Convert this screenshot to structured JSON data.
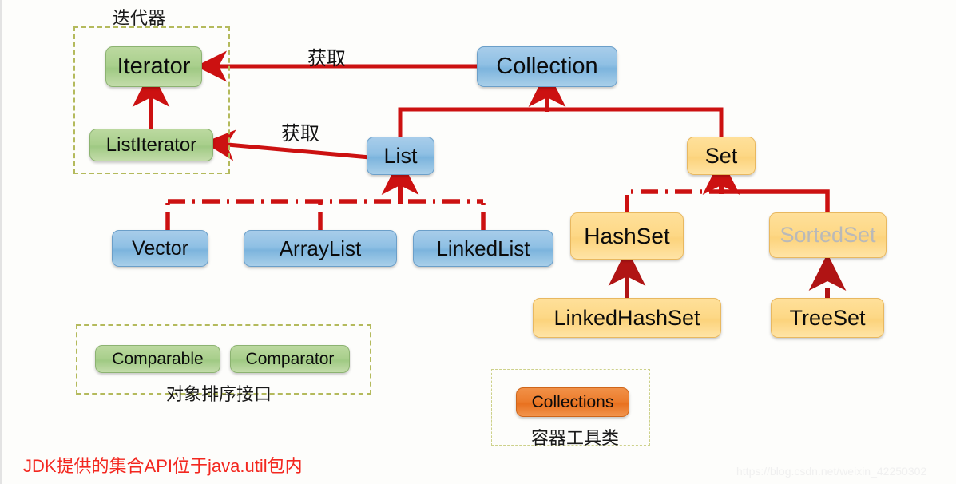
{
  "diagram": {
    "title_note": "JDK Collection API hierarchy",
    "colors": {
      "arrow_red": "#cc1111",
      "dark_red": "#b01414",
      "blue_box": "#8fc0e4",
      "green_box": "#a9cf8c",
      "amber_box": "#fdd886",
      "orange_box": "#ec7c2c",
      "frame_olive": "#b4ba5c",
      "footnote_red": "#f3271f",
      "muted_gray": "#b9b9b9",
      "background": "#fdfdfb"
    }
  },
  "nodes": {
    "iterator": {
      "label": "Iterator",
      "style": "green"
    },
    "list_iterator": {
      "label": "ListIterator",
      "style": "green"
    },
    "collection": {
      "label": "Collection",
      "style": "blue"
    },
    "list": {
      "label": "List",
      "style": "blue"
    },
    "set": {
      "label": "Set",
      "style": "amber"
    },
    "vector": {
      "label": "Vector",
      "style": "blue"
    },
    "array_list": {
      "label": "ArrayList",
      "style": "blue"
    },
    "linked_list": {
      "label": "LinkedList",
      "style": "blue"
    },
    "hash_set": {
      "label": "HashSet",
      "style": "amber"
    },
    "sorted_set": {
      "label": "SortedSet",
      "style": "amber-muted"
    },
    "linked_hash_set": {
      "label": "LinkedHashSet",
      "style": "amber"
    },
    "tree_set": {
      "label": "TreeSet",
      "style": "amber"
    },
    "comparable": {
      "label": "Comparable",
      "style": "green"
    },
    "comparator": {
      "label": "Comparator",
      "style": "green"
    },
    "collections": {
      "label": "Collections",
      "style": "orange"
    }
  },
  "groups": {
    "iterator_group": {
      "caption": "迭代器"
    },
    "sorting_group": {
      "caption": "对象排序接口"
    },
    "utility_group": {
      "caption": "容器工具类"
    }
  },
  "edge_labels": {
    "collection_to_iterator": "获取",
    "list_to_list_iterator": "获取"
  },
  "footnote": {
    "text": "JDK提供的集合API位于java.util包内"
  },
  "watermark": {
    "text": "https://blog.csdn.net/weixin_42250302"
  }
}
